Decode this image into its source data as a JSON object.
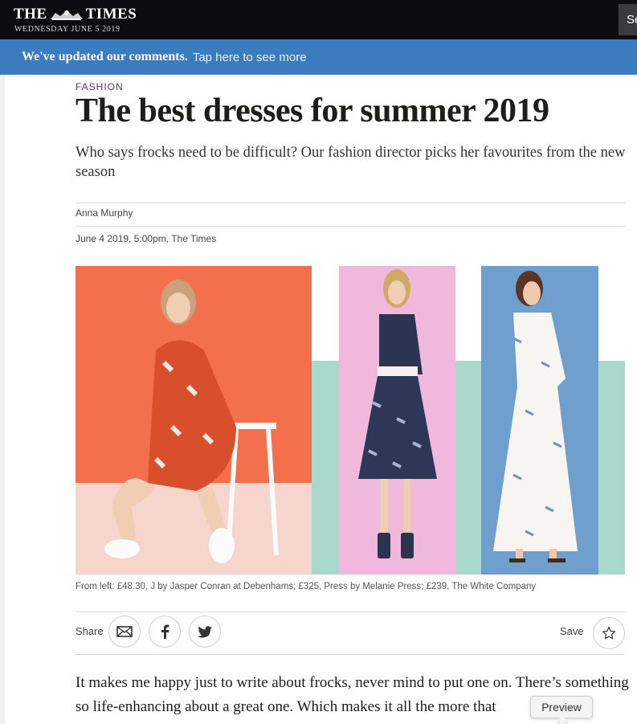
{
  "masthead": {
    "logo_left": "THE",
    "logo_right": "TIMES",
    "date": "WEDNESDAY JUNE 5 2019",
    "search_label": "Search"
  },
  "banner": {
    "strong": "We've updated our comments.",
    "link": "Tap here to see more"
  },
  "article": {
    "section": "FASHION",
    "headline": "The best dresses for summer 2019",
    "standfirst": "Who says frocks need to be difficult? Our fashion director picks her favourites from the new season",
    "author": "Anna Murphy",
    "published": "June 4 2019, 5:00pm, The Times",
    "caption": "From left: £48.30, J by Jasper Conran at Debenhams; £325, Press by Melanie Press; £239, The White Company",
    "body": "It makes me happy just to write about frocks, never mind to put one on. There’s something so life-enhancing about a great one. Which makes it all the more that"
  },
  "actions": {
    "share_label": "Share",
    "save_label": "Save",
    "icons": [
      "email-icon",
      "facebook-icon",
      "twitter-icon",
      "star-icon"
    ]
  },
  "tooltip": {
    "label": "Preview"
  },
  "colors": {
    "masthead_bg": "#0c0c12",
    "banner_bg": "#3b7cc0",
    "section_kicker": "#6b2a6f",
    "image_orange": "#f46f4c",
    "image_pink": "#f1b8dd",
    "image_blue": "#6f9fcc",
    "image_mint": "#a9d9cb"
  }
}
